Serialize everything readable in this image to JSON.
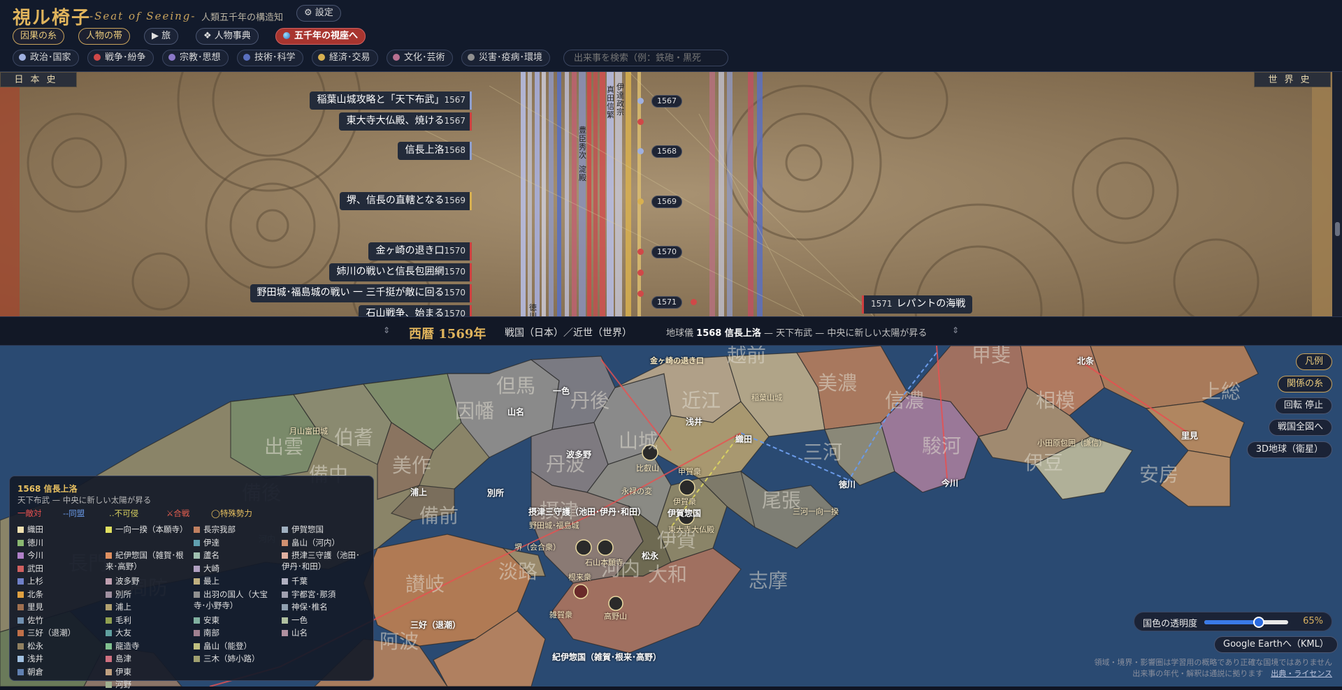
{
  "header": {
    "title": "視ル椅子",
    "subtitle": "-Seat of Seeing-",
    "tagline": "人類五千年の構造知",
    "settings": "⚙ 設定",
    "buttons": {
      "causal": "因果の糸",
      "people": "人物の帯",
      "tour": "▶ 旅",
      "dict": "❖ 人物事典",
      "seat": "五千年の視座へ"
    },
    "categories": [
      {
        "label": "政治･国家",
        "color": "#9fb0e0"
      },
      {
        "label": "戦争･紛争",
        "color": "#d04848"
      },
      {
        "label": "宗教･思想",
        "color": "#8a78c8"
      },
      {
        "label": "技術･科学",
        "color": "#5a70c0"
      },
      {
        "label": "経済･交易",
        "color": "#d8b050"
      },
      {
        "label": "文化･芸術",
        "color": "#b87090"
      },
      {
        "label": "災害･疫病･環境",
        "color": "#909090"
      }
    ],
    "search_placeholder": "出来事を検索（例：鉄砲・黒死"
  },
  "timeline": {
    "japan_label": "日本史",
    "world_label": "世界史",
    "events": [
      {
        "title": "稲葉山城攻略と「天下布武」",
        "year": "1567",
        "type": "pol"
      },
      {
        "title": "東大寺大仏殿、焼ける",
        "year": "1567",
        "type": "war"
      },
      {
        "title": "信長上洛",
        "year": "1568",
        "type": "pol"
      },
      {
        "title": "堺、信長の直轄となる",
        "year": "1569",
        "type": "eco"
      },
      {
        "title": "金ヶ崎の退き口",
        "year": "1570",
        "type": "war"
      },
      {
        "title": "姉川の戦いと信長包囲網",
        "year": "1570",
        "type": "war"
      },
      {
        "title": "野田城･福島城の戦い 一 三千挺が敵に回る",
        "year": "1570",
        "type": "war"
      },
      {
        "title": "石山戦争、始まる",
        "year": "1570",
        "type": "war"
      }
    ],
    "year_tags": [
      "1567",
      "1568",
      "1569",
      "1570",
      "1571"
    ],
    "bands": [
      "伊達政宗",
      "真田信繁",
      "豊臣秀次",
      "淀殿",
      "徳川家康"
    ],
    "world_event": {
      "year": "1571",
      "title": "レパントの海戦"
    }
  },
  "status": {
    "year": "西暦 1569年",
    "era": "戦国（日本）／近世（世界）",
    "globe_prefix": "地球儀",
    "globe_event": "1568 信長上洛",
    "globe_desc": "— 天下布武 — 中央に新しい太陽が昇る",
    "arrow": "⇕"
  },
  "map": {
    "buttons": {
      "legend": "凡例",
      "relations": "関係の糸",
      "rotate": "回転 停止",
      "overview": "戦国全図へ",
      "globe3d": "3D地球（衛星）"
    },
    "opacity": {
      "label": "国色の透明度",
      "value": "65%",
      "level": 65
    },
    "gearth": "Google Earthへ（KML）",
    "disclaimer1": "領域・境界・影響圏は学習用の概略であり正確な国境ではありません",
    "disclaimer2": "出来事の年代・解釈は通説に拠ります",
    "license": "出典・ライセンス",
    "provinces": [
      "越前",
      "甲斐",
      "但馬",
      "丹後",
      "近江",
      "美濃",
      "信濃",
      "相模",
      "上総",
      "因幡",
      "山城",
      "三河",
      "駿河",
      "伊豆",
      "安房",
      "出雲",
      "伯耆",
      "美作",
      "丹波",
      "備中",
      "備後",
      "備前",
      "尾張",
      "摂津",
      "伊賀",
      "讃岐",
      "淡路",
      "大和",
      "志摩",
      "阿波",
      "河内",
      "長門",
      "周防"
    ],
    "places": [
      "金ヶ崎の退き口",
      "一色",
      "山名",
      "浅井",
      "稲葉山城",
      "北条",
      "織田",
      "月山富田城",
      "波多野",
      "比叡山",
      "甲賀衆",
      "徳川",
      "今川",
      "小田原包囲（謙信）",
      "里見",
      "浦上",
      "別所",
      "永禄の変",
      "伊賀衆",
      "伊賀惣国",
      "三河一向一揆",
      "摂津三守護（池田･伊丹･和田）",
      "野田城･福島城",
      "東大寺大仏殿",
      "堺（会合衆）",
      "石山本願寺",
      "松永",
      "根来衆",
      "雑賀衆",
      "高野山",
      "三好（退潮）",
      "紀伊惣国（雑賀･根来･高野）",
      "河内"
    ],
    "legend": {
      "title": "1568 信長上洛",
      "subtitle": "天下布武 — 中央に新しい太陽が昇る",
      "relations": [
        {
          "label": "一敵対",
          "color": "#e85050"
        },
        {
          "label": "--同盟",
          "color": "#6a9ae8"
        },
        {
          "label": "‥不可侵",
          "color": "#d8d060"
        },
        {
          "label": "⚔合戦",
          "color": "#e86050"
        },
        {
          "label": "◯特殊勢力",
          "color": "#e8c060"
        }
      ],
      "clans": [
        {
          "name": "織田",
          "color": "#f0e0b0"
        },
        {
          "name": "徳川",
          "color": "#8ab870"
        },
        {
          "name": "今川",
          "color": "#b080c8"
        },
        {
          "name": "武田",
          "color": "#d06060"
        },
        {
          "name": "上杉",
          "color": "#7080c8"
        },
        {
          "name": "北条",
          "color": "#e0a040"
        },
        {
          "name": "里見",
          "color": "#a07050"
        },
        {
          "name": "佐竹",
          "color": "#7090b0"
        },
        {
          "name": "三好（退潮）",
          "color": "#c07048"
        },
        {
          "name": "松永",
          "color": "#908060"
        },
        {
          "name": "浅井",
          "color": "#a0c0e0"
        },
        {
          "name": "朝倉",
          "color": "#6080b0"
        },
        {
          "name": "一向一揆（本願寺）",
          "color": "#e0e060"
        },
        {
          "name": "紀伊惣国（雑賀･根来･高野）",
          "color": "#e09060"
        },
        {
          "name": "波多野",
          "color": "#c0a0b0"
        },
        {
          "name": "別所",
          "color": "#a090a0"
        },
        {
          "name": "浦上",
          "color": "#b0a070"
        },
        {
          "name": "毛利",
          "color": "#90a050"
        },
        {
          "name": "大友",
          "color": "#60a0a0"
        },
        {
          "name": "龍造寺",
          "color": "#80c090"
        },
        {
          "name": "島津",
          "color": "#d07080"
        },
        {
          "name": "伊東",
          "color": "#c0a080"
        },
        {
          "name": "河野",
          "color": "#a0b090"
        },
        {
          "name": "長宗我部",
          "color": "#c08060"
        },
        {
          "name": "伊達",
          "color": "#60a0b0"
        },
        {
          "name": "蘆名",
          "color": "#a0c0b0"
        },
        {
          "name": "大崎",
          "color": "#b0a0c0"
        },
        {
          "name": "最上",
          "color": "#c0b080"
        },
        {
          "name": "出羽の国人（大宝寺･小野寺）",
          "color": "#909090"
        },
        {
          "name": "安東",
          "color": "#80b0a0"
        },
        {
          "name": "南部",
          "color": "#a08090"
        },
        {
          "name": "畠山（能登）",
          "color": "#c0c080"
        },
        {
          "name": "三木（姉小路）",
          "color": "#a0a070"
        },
        {
          "name": "伊賀惣国",
          "color": "#a0b0c0"
        },
        {
          "name": "畠山（河内）",
          "color": "#d09070"
        },
        {
          "name": "摂津三守護（池田･伊丹･和田）",
          "color": "#e0b0a0"
        },
        {
          "name": "千葉",
          "color": "#b0b0c0"
        },
        {
          "name": "宇都宮･那須",
          "color": "#a0a0b0"
        },
        {
          "name": "神保･椎名",
          "color": "#90a0b0"
        },
        {
          "name": "一色",
          "color": "#b0c0a0"
        },
        {
          "name": "山名",
          "color": "#b090a0"
        }
      ]
    }
  }
}
